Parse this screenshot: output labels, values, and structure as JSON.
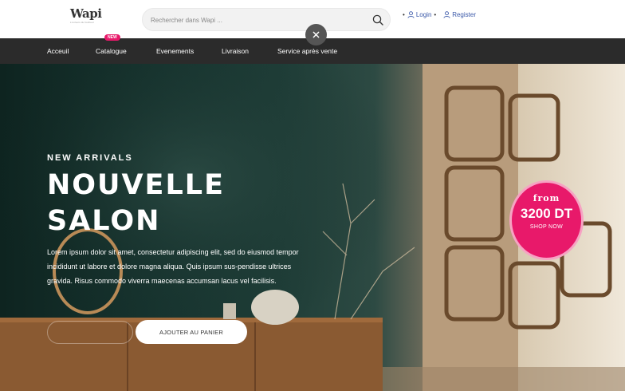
{
  "header": {
    "logo_text": "Wapi",
    "logo_tagline": "L'univers du bonheur",
    "search": {
      "placeholder": "Rechercher dans Wapi ...",
      "value": ""
    },
    "auth": {
      "separator": "•",
      "login_label": "Login",
      "register_label": "Register"
    }
  },
  "nav": {
    "items": [
      {
        "label": "Acceuil"
      },
      {
        "label": "Catalogue",
        "badge": "NEW"
      },
      {
        "label": "Evenements"
      },
      {
        "label": "Livraison"
      },
      {
        "label": "Service après vente"
      }
    ]
  },
  "hero": {
    "eyebrow": "NEW ARRIVALS",
    "title_line1": "NOUVELLE",
    "title_line2": "SALON",
    "description": "Lorem ipsum dolor sit amet, consectetur adipiscing elit, sed do eiusmod tempor incididunt ut labore et dolore magna aliqua. Quis ipsum sus-pendisse ultrices gravida. Risus commodo viverra maecenas accumsan lacus vel facilisis.",
    "cart_button_label": "AJOUTER AU PANIER",
    "promo": {
      "from": "from",
      "price": "3200 DT",
      "shop_label": "SHOP NOW"
    }
  },
  "colors": {
    "nav_background": "#2b2b2b",
    "accent_pink": "#e8196a",
    "link_blue": "#3a58a8"
  },
  "icons": [
    "search-icon",
    "close-icon",
    "user-icon"
  ]
}
